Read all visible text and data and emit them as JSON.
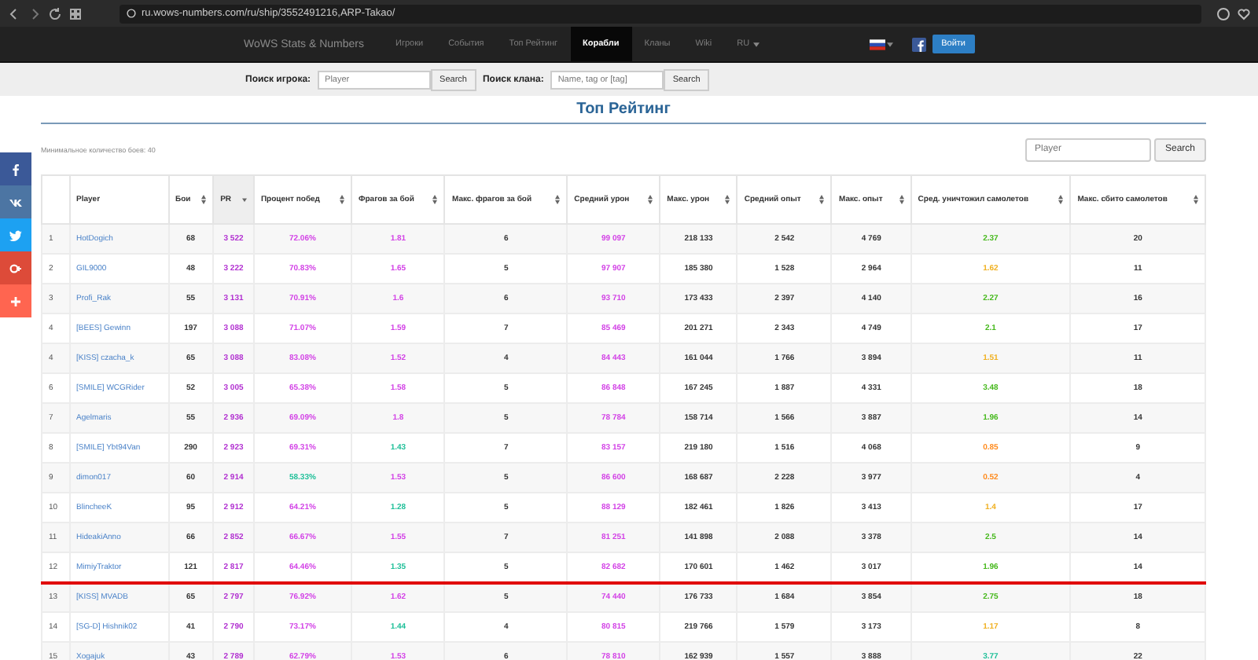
{
  "browser": {
    "url": "ru.wows-numbers.com/ru/ship/3552491216,ARP-Takao/"
  },
  "nav": {
    "brand": "WoWS Stats & Numbers",
    "items": [
      {
        "label": "Игроки",
        "selected": false
      },
      {
        "label": "События",
        "selected": false
      },
      {
        "label": "Топ Рейтинг",
        "selected": false
      },
      {
        "label": "Корабли",
        "selected": true
      },
      {
        "label": "Кланы",
        "selected": false
      },
      {
        "label": "Wiki",
        "selected": false
      },
      {
        "label": "RU",
        "selected": false
      }
    ],
    "login": "Войти"
  },
  "search": {
    "player_label": "Поиск игрока:",
    "player_placeholder": "Player",
    "player_button": "Search",
    "clan_label": "Поиск клана:",
    "clan_placeholder": "Name, tag or [tag]",
    "clan_button": "Search"
  },
  "title": "Топ Рейтинг",
  "min_battles": "Минимальное количество боев: 40",
  "filter": {
    "placeholder": "Player",
    "button": "Search"
  },
  "social": [
    {
      "kind": "facebook",
      "color": "#3b5998"
    },
    {
      "kind": "vk",
      "color": "#4c75a3"
    },
    {
      "kind": "twitter",
      "color": "#1da1f2"
    },
    {
      "kind": "gplus",
      "color": "#dd4b39"
    },
    {
      "kind": "plus",
      "color": "#ff6550"
    }
  ],
  "columns": [
    {
      "label": "Player",
      "sortable": false,
      "sorted": false
    },
    {
      "label": "Бои",
      "sortable": true,
      "sorted": false
    },
    {
      "label": "PR",
      "sortable": true,
      "sorted": true
    },
    {
      "label": "Процент побед",
      "sortable": true,
      "sorted": false
    },
    {
      "label": "Фрагов за бой",
      "sortable": true,
      "sorted": false
    },
    {
      "label": "Макс. фрагов за бой",
      "sortable": true,
      "sorted": false
    },
    {
      "label": "Средний урон",
      "sortable": true,
      "sorted": false
    },
    {
      "label": "Макс. урон",
      "sortable": true,
      "sorted": false
    },
    {
      "label": "Средний опыт",
      "sortable": true,
      "sorted": false
    },
    {
      "label": "Макс. опыт",
      "sortable": true,
      "sorted": false
    },
    {
      "label": "Сред. уничтожил самолетов",
      "sortable": true,
      "sorted": false
    },
    {
      "label": "Макс. сбито самолетов",
      "sortable": true,
      "sorted": false
    }
  ],
  "rows": [
    {
      "underlined": false,
      "cells": [
        {
          "text": "1"
        },
        {
          "text": "HotDogich",
          "kind": "link"
        },
        {
          "text": "68"
        },
        {
          "text": "3 522",
          "color": "#b02cd0"
        },
        {
          "text": "72.06%",
          "color": "#d23fe6"
        },
        {
          "text": "1.81",
          "color": "#d23fe6"
        },
        {
          "text": "6"
        },
        {
          "text": "99 097",
          "color": "#d23fe6"
        },
        {
          "text": "218 133"
        },
        {
          "text": "2 542"
        },
        {
          "text": "4 769"
        },
        {
          "text": "2.37",
          "color": "#44b81a"
        },
        {
          "text": "20"
        }
      ]
    },
    {
      "underlined": false,
      "cells": [
        {
          "text": "2"
        },
        {
          "text": "GIL9000",
          "kind": "link"
        },
        {
          "text": "48"
        },
        {
          "text": "3 222",
          "color": "#b02cd0"
        },
        {
          "text": "70.83%",
          "color": "#d23fe6"
        },
        {
          "text": "1.65",
          "color": "#d23fe6"
        },
        {
          "text": "5"
        },
        {
          "text": "97 907",
          "color": "#d23fe6"
        },
        {
          "text": "185 380"
        },
        {
          "text": "1 528"
        },
        {
          "text": "2 964"
        },
        {
          "text": "1.62",
          "color": "#f0b020"
        },
        {
          "text": "11"
        }
      ]
    },
    {
      "underlined": false,
      "cells": [
        {
          "text": "3"
        },
        {
          "text": "Profi_Rak",
          "kind": "link"
        },
        {
          "text": "55"
        },
        {
          "text": "3 131",
          "color": "#b02cd0"
        },
        {
          "text": "70.91%",
          "color": "#d23fe6"
        },
        {
          "text": "1.6",
          "color": "#d23fe6"
        },
        {
          "text": "6"
        },
        {
          "text": "93 710",
          "color": "#d23fe6"
        },
        {
          "text": "173 433"
        },
        {
          "text": "2 397"
        },
        {
          "text": "4 140"
        },
        {
          "text": "2.27",
          "color": "#44b81a"
        },
        {
          "text": "16"
        }
      ]
    },
    {
      "underlined": false,
      "cells": [
        {
          "text": "4"
        },
        {
          "text": "[BEES] Gewinn",
          "kind": "link"
        },
        {
          "text": "197"
        },
        {
          "text": "3 088",
          "color": "#b02cd0"
        },
        {
          "text": "71.07%",
          "color": "#d23fe6"
        },
        {
          "text": "1.59",
          "color": "#d23fe6"
        },
        {
          "text": "7"
        },
        {
          "text": "85 469",
          "color": "#d23fe6"
        },
        {
          "text": "201 271"
        },
        {
          "text": "2 343"
        },
        {
          "text": "4 749"
        },
        {
          "text": "2.1",
          "color": "#44b81a"
        },
        {
          "text": "17"
        }
      ]
    },
    {
      "underlined": false,
      "cells": [
        {
          "text": "4"
        },
        {
          "text": "[KISS] czacha_k",
          "kind": "link"
        },
        {
          "text": "65"
        },
        {
          "text": "3 088",
          "color": "#b02cd0"
        },
        {
          "text": "83.08%",
          "color": "#d23fe6"
        },
        {
          "text": "1.52",
          "color": "#d23fe6"
        },
        {
          "text": "4"
        },
        {
          "text": "84 443",
          "color": "#d23fe6"
        },
        {
          "text": "161 044"
        },
        {
          "text": "1 766"
        },
        {
          "text": "3 894"
        },
        {
          "text": "1.51",
          "color": "#f0b020"
        },
        {
          "text": "11"
        }
      ]
    },
    {
      "underlined": false,
      "cells": [
        {
          "text": "6"
        },
        {
          "text": "[SMILE] WCGRider",
          "kind": "link"
        },
        {
          "text": "52"
        },
        {
          "text": "3 005",
          "color": "#b02cd0"
        },
        {
          "text": "65.38%",
          "color": "#d23fe6"
        },
        {
          "text": "1.58",
          "color": "#d23fe6"
        },
        {
          "text": "5"
        },
        {
          "text": "86 848",
          "color": "#d23fe6"
        },
        {
          "text": "167 245"
        },
        {
          "text": "1 887"
        },
        {
          "text": "4 331"
        },
        {
          "text": "3.48",
          "color": "#44b81a"
        },
        {
          "text": "18"
        }
      ]
    },
    {
      "underlined": false,
      "cells": [
        {
          "text": "7"
        },
        {
          "text": "Agelmaris",
          "kind": "link"
        },
        {
          "text": "55"
        },
        {
          "text": "2 936",
          "color": "#b02cd0"
        },
        {
          "text": "69.09%",
          "color": "#d23fe6"
        },
        {
          "text": "1.8",
          "color": "#d23fe6"
        },
        {
          "text": "5"
        },
        {
          "text": "78 784",
          "color": "#d23fe6"
        },
        {
          "text": "158 714"
        },
        {
          "text": "1 566"
        },
        {
          "text": "3 887"
        },
        {
          "text": "1.96",
          "color": "#44b81a"
        },
        {
          "text": "14"
        }
      ]
    },
    {
      "underlined": false,
      "cells": [
        {
          "text": "8"
        },
        {
          "text": "[SMILE] Ybt94Van",
          "kind": "link"
        },
        {
          "text": "290"
        },
        {
          "text": "2 923",
          "color": "#b02cd0"
        },
        {
          "text": "69.31%",
          "color": "#d23fe6"
        },
        {
          "text": "1.43",
          "color": "#1dbf98"
        },
        {
          "text": "7"
        },
        {
          "text": "83 157",
          "color": "#d23fe6"
        },
        {
          "text": "219 180"
        },
        {
          "text": "1 516"
        },
        {
          "text": "4 068"
        },
        {
          "text": "0.85",
          "color": "#ff8a1c"
        },
        {
          "text": "9"
        }
      ]
    },
    {
      "underlined": false,
      "cells": [
        {
          "text": "9"
        },
        {
          "text": "dimon017",
          "kind": "link"
        },
        {
          "text": "60"
        },
        {
          "text": "2 914",
          "color": "#b02cd0"
        },
        {
          "text": "58.33%",
          "color": "#1dbf98"
        },
        {
          "text": "1.53",
          "color": "#d23fe6"
        },
        {
          "text": "5"
        },
        {
          "text": "86 600",
          "color": "#d23fe6"
        },
        {
          "text": "168 687"
        },
        {
          "text": "2 228"
        },
        {
          "text": "3 977"
        },
        {
          "text": "0.52",
          "color": "#ff8a1c"
        },
        {
          "text": "4"
        }
      ]
    },
    {
      "underlined": false,
      "cells": [
        {
          "text": "10"
        },
        {
          "text": "BlincheeK",
          "kind": "link"
        },
        {
          "text": "95"
        },
        {
          "text": "2 912",
          "color": "#b02cd0"
        },
        {
          "text": "64.21%",
          "color": "#d23fe6"
        },
        {
          "text": "1.28",
          "color": "#1dbf98"
        },
        {
          "text": "5"
        },
        {
          "text": "88 129",
          "color": "#d23fe6"
        },
        {
          "text": "182 461"
        },
        {
          "text": "1 826"
        },
        {
          "text": "3 413"
        },
        {
          "text": "1.4",
          "color": "#f0b020"
        },
        {
          "text": "17"
        }
      ]
    },
    {
      "underlined": false,
      "cells": [
        {
          "text": "11"
        },
        {
          "text": "HideakiAnno",
          "kind": "link"
        },
        {
          "text": "66"
        },
        {
          "text": "2 852",
          "color": "#b02cd0"
        },
        {
          "text": "66.67%",
          "color": "#d23fe6"
        },
        {
          "text": "1.55",
          "color": "#d23fe6"
        },
        {
          "text": "7"
        },
        {
          "text": "81 251",
          "color": "#d23fe6"
        },
        {
          "text": "141 898"
        },
        {
          "text": "2 088"
        },
        {
          "text": "3 378"
        },
        {
          "text": "2.5",
          "color": "#44b81a"
        },
        {
          "text": "14"
        }
      ]
    },
    {
      "underlined": true,
      "cells": [
        {
          "text": "12"
        },
        {
          "text": "MimiyTraktor",
          "kind": "link"
        },
        {
          "text": "121"
        },
        {
          "text": "2 817",
          "color": "#b02cd0"
        },
        {
          "text": "64.46%",
          "color": "#d23fe6"
        },
        {
          "text": "1.35",
          "color": "#1dbf98"
        },
        {
          "text": "5"
        },
        {
          "text": "82 682",
          "color": "#d23fe6"
        },
        {
          "text": "170 601"
        },
        {
          "text": "1 462"
        },
        {
          "text": "3 017"
        },
        {
          "text": "1.96",
          "color": "#44b81a"
        },
        {
          "text": "14"
        }
      ]
    },
    {
      "underlined": false,
      "cells": [
        {
          "text": "13"
        },
        {
          "text": "[KISS] MVADB",
          "kind": "link"
        },
        {
          "text": "65"
        },
        {
          "text": "2 797",
          "color": "#b02cd0"
        },
        {
          "text": "76.92%",
          "color": "#d23fe6"
        },
        {
          "text": "1.62",
          "color": "#d23fe6"
        },
        {
          "text": "5"
        },
        {
          "text": "74 440",
          "color": "#d23fe6"
        },
        {
          "text": "176 733"
        },
        {
          "text": "1 684"
        },
        {
          "text": "3 854"
        },
        {
          "text": "2.75",
          "color": "#44b81a"
        },
        {
          "text": "18"
        }
      ]
    },
    {
      "underlined": false,
      "cells": [
        {
          "text": "14"
        },
        {
          "text": "[SG-D] Hishnik02",
          "kind": "link"
        },
        {
          "text": "41"
        },
        {
          "text": "2 790",
          "color": "#b02cd0"
        },
        {
          "text": "73.17%",
          "color": "#d23fe6"
        },
        {
          "text": "1.44",
          "color": "#1dbf98"
        },
        {
          "text": "4"
        },
        {
          "text": "80 815",
          "color": "#d23fe6"
        },
        {
          "text": "219 766"
        },
        {
          "text": "1 579"
        },
        {
          "text": "3 173"
        },
        {
          "text": "1.17",
          "color": "#f0b020"
        },
        {
          "text": "8"
        }
      ]
    },
    {
      "underlined": false,
      "cells": [
        {
          "text": "15"
        },
        {
          "text": "Xogajuk",
          "kind": "link"
        },
        {
          "text": "43"
        },
        {
          "text": "2 789",
          "color": "#b02cd0"
        },
        {
          "text": "62.79%",
          "color": "#d23fe6"
        },
        {
          "text": "1.53",
          "color": "#d23fe6"
        },
        {
          "text": "6"
        },
        {
          "text": "78 810",
          "color": "#d23fe6"
        },
        {
          "text": "162 939"
        },
        {
          "text": "1 557"
        },
        {
          "text": "3 888"
        },
        {
          "text": "3.77",
          "color": "#1dbf98"
        },
        {
          "text": "22"
        }
      ]
    }
  ]
}
